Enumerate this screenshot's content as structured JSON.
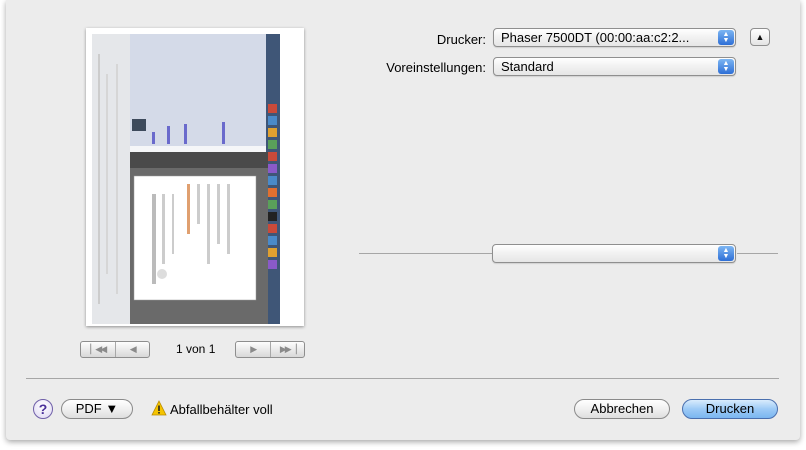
{
  "preview": {
    "page_count": "1 von 1",
    "first_icon": "first-page-icon",
    "prev_icon": "previous-page-icon",
    "next_icon": "next-page-icon",
    "last_icon": "last-page-icon"
  },
  "form": {
    "printer_label": "Drucker:",
    "printer_value": "Phaser 7500DT (00:00:aa:c2:2...",
    "presets_label": "Voreinstellungen:",
    "presets_value": "Standard",
    "section_value": ""
  },
  "footer": {
    "help_label": "?",
    "pdf_label": "PDF ▼",
    "warning_text": "Abfallbehälter voll",
    "cancel_label": "Abbrechen",
    "print_label": "Drucken"
  },
  "colors": {
    "sheet_bg": "#ececec",
    "accent_blue": "#7bb6f0",
    "warning_yellow": "#f5c400"
  }
}
